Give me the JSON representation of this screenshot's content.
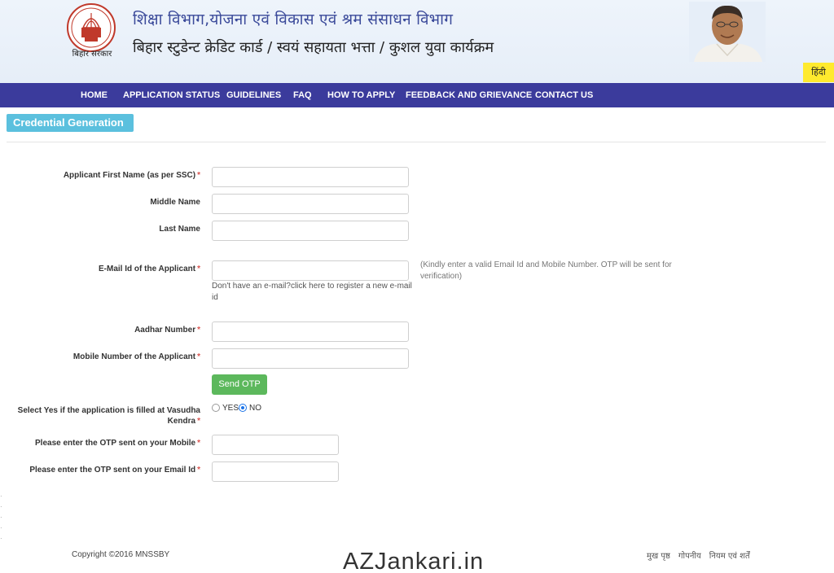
{
  "header": {
    "emblem_caption": "बिहार सरकार",
    "title_line1": "शिक्षा विभाग,योजना एवं विकास एवं श्रम संसाधन विभाग",
    "title_line2": "बिहार स्टुडेन्ट क्रेडिट कार्ड / स्वयं सहायता भत्ता / कुशल युवा कार्यक्रम",
    "language_button": "हिंदी"
  },
  "nav": {
    "items": [
      "HOME",
      "APPLICATION STATUS",
      "GUIDELINES",
      "FAQ",
      "HOW TO APPLY",
      "FEEDBACK AND GRIEVANCE",
      "CONTACT US"
    ]
  },
  "section": {
    "title": "Credential Generation"
  },
  "form": {
    "first_name_label": "Applicant First Name (as per SSC)",
    "middle_name_label": "Middle Name",
    "last_name_label": "Last Name",
    "email_label": "E-Mail Id of the Applicant",
    "email_helper": "Don't have an e-mail?click here to register a new e-mail id",
    "email_note": "(Kindly enter a valid Email Id and Mobile Number. OTP will be sent for verification)",
    "aadhar_label": "Aadhar Number",
    "mobile_label": "Mobile Number of the Applicant",
    "send_otp_label": "Send OTP",
    "vasudha_label": "Select Yes if the application is filled at Vasudha Kendra",
    "vasudha_options": [
      "YES",
      "NO"
    ],
    "vasudha_selected": "NO",
    "mobile_otp_label": "Please enter the OTP sent on your Mobile",
    "email_otp_label": "Please enter the OTP sent on your Email Id",
    "required_marker": "*"
  },
  "footer": {
    "copyright": "Copyright ©2016 MNSSBY",
    "watermark": "AZJankari.in",
    "links": [
      "मुख पृष्ठ",
      "गोपनीय",
      "नियम एवं शर्तें"
    ]
  },
  "colors": {
    "nav_bg": "#3b3b9c",
    "section_tab": "#5bc0de",
    "send_otp": "#5cb85c",
    "language_button": "#ffea2e",
    "required": "#d9534f",
    "title_blue": "#3b4a9a"
  }
}
